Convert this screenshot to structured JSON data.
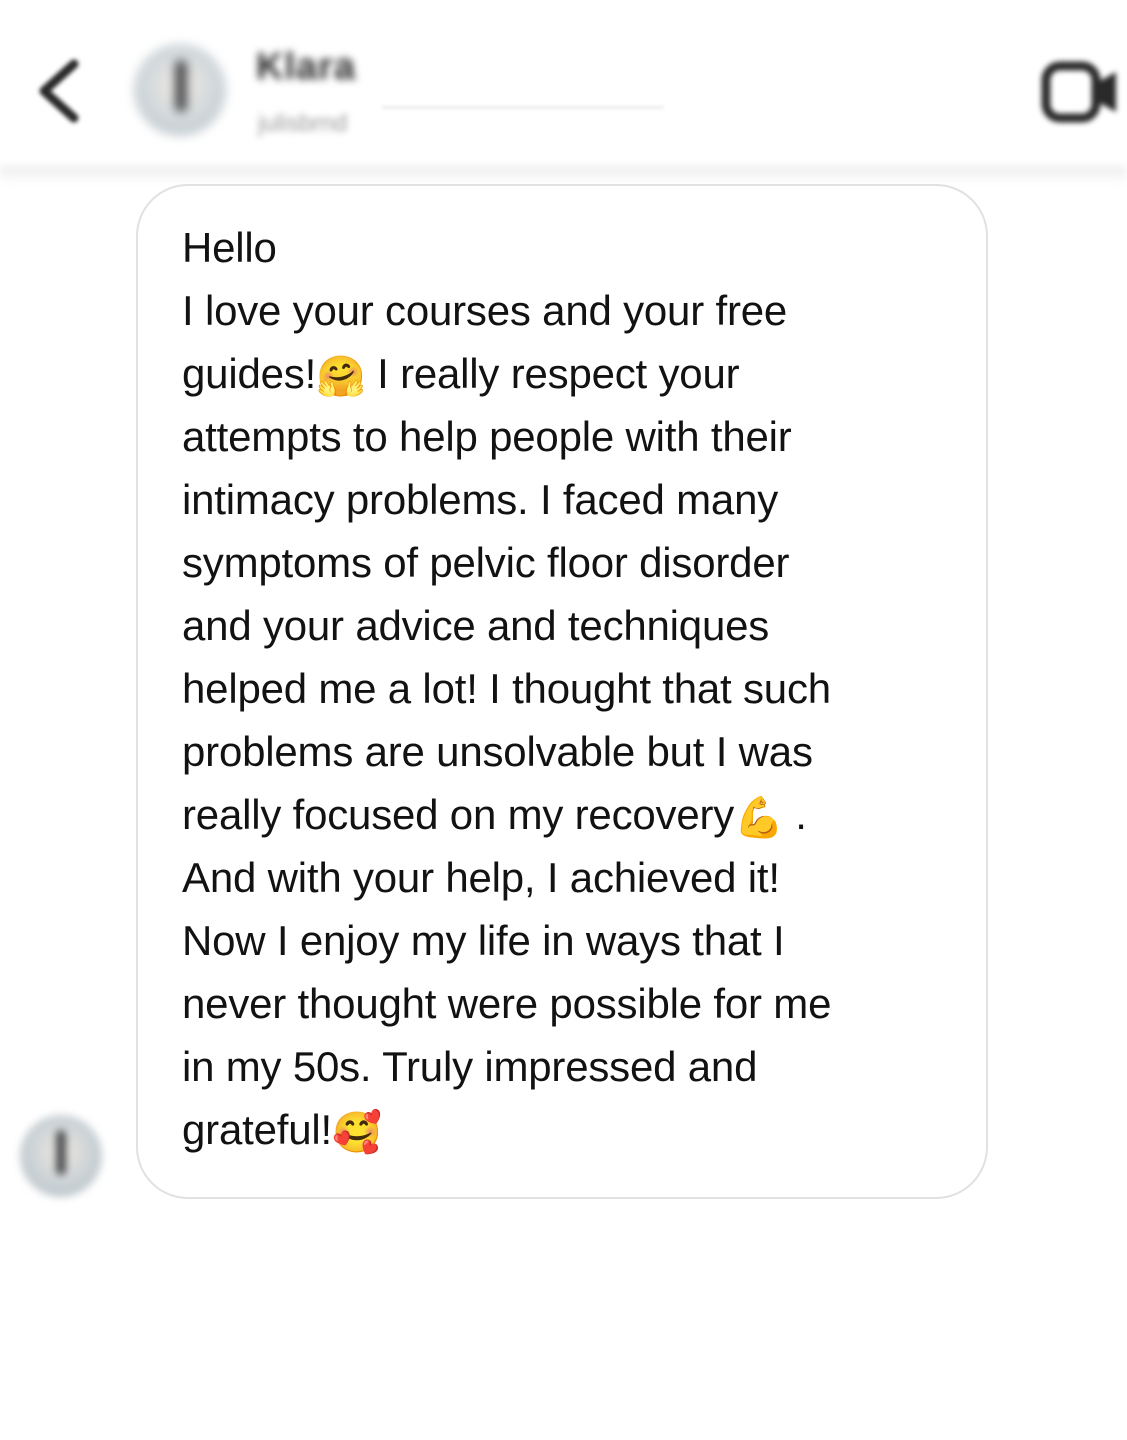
{
  "header": {
    "contact_name": "Klara",
    "contact_username": "julisbrnd",
    "icons": {
      "back": "chevron-left-icon",
      "video_call": "video-camera-icon"
    }
  },
  "message": {
    "lines": [
      {
        "text": "Hello",
        "emoji": "",
        "emoji_name": "",
        "after": ""
      },
      {
        "text": "I love your courses and your free",
        "emoji": "",
        "emoji_name": "",
        "after": ""
      },
      {
        "text": "guides!",
        "emoji": "🤗",
        "emoji_name": "hugging-face-emoji",
        "after": " I really respect your"
      },
      {
        "text": "attempts to help people with their",
        "emoji": "",
        "emoji_name": "",
        "after": ""
      },
      {
        "text": "intimacy problems. I faced many",
        "emoji": "",
        "emoji_name": "",
        "after": ""
      },
      {
        "text": "symptoms of pelvic floor disorder",
        "emoji": "",
        "emoji_name": "",
        "after": ""
      },
      {
        "text": "and your advice and techniques",
        "emoji": "",
        "emoji_name": "",
        "after": ""
      },
      {
        "text": "helped me a lot! I thought that such",
        "emoji": "",
        "emoji_name": "",
        "after": ""
      },
      {
        "text": "problems are unsolvable but I was",
        "emoji": "",
        "emoji_name": "",
        "after": ""
      },
      {
        "text": "really focused on my recovery",
        "emoji": "💪",
        "emoji_name": "flexed-biceps-emoji",
        "after": " ."
      },
      {
        "text": "And with your help, I achieved it!",
        "emoji": "",
        "emoji_name": "",
        "after": ""
      },
      {
        "text": "Now I enjoy my life in ways that I",
        "emoji": "",
        "emoji_name": "",
        "after": ""
      },
      {
        "text": "never thought were possible for me",
        "emoji": "",
        "emoji_name": "",
        "after": ""
      },
      {
        "text": "in my 50s. Truly impressed and",
        "emoji": "",
        "emoji_name": "",
        "after": ""
      },
      {
        "text": "grateful!",
        "emoji": "🥰",
        "emoji_name": "smiling-face-with-hearts-emoji",
        "after": ""
      }
    ]
  },
  "colors": {
    "bubble_border": "#e1e1e1",
    "text": "#121212",
    "background": "#ffffff"
  }
}
